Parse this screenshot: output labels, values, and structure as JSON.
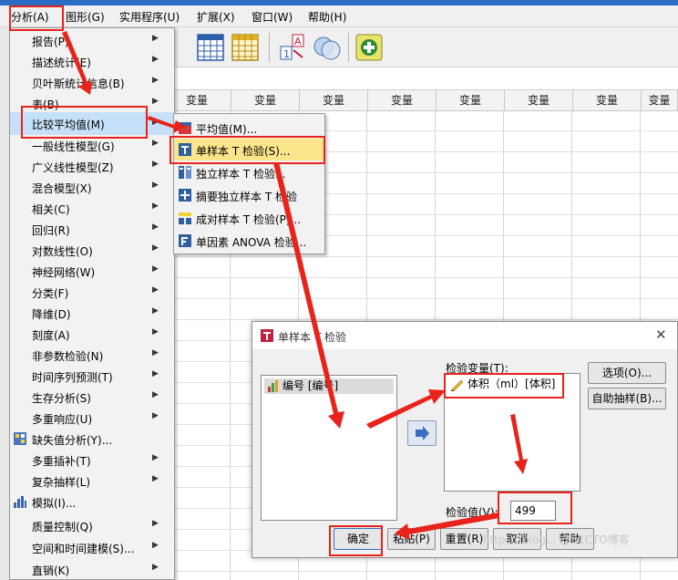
{
  "menubar": {
    "items": [
      "分析(A)",
      "图形(G)",
      "实用程序(U)",
      "扩展(X)",
      "窗口(W)",
      "帮助(H)"
    ]
  },
  "grid": {
    "column_header": "变量"
  },
  "analyze_menu": {
    "items": [
      {
        "label": "报告(P)",
        "submenu": true
      },
      {
        "label": "描述统计(E)",
        "submenu": true
      },
      {
        "label": "贝叶斯统计信息(B)",
        "submenu": true
      },
      {
        "label": "表(B)",
        "submenu": true
      },
      {
        "label": "比较平均值(M)",
        "submenu": true,
        "highlighted": true
      },
      {
        "label": "一般线性模型(G)",
        "submenu": true
      },
      {
        "label": "广义线性模型(Z)",
        "submenu": true
      },
      {
        "label": "混合模型(X)",
        "submenu": true
      },
      {
        "label": "相关(C)",
        "submenu": true
      },
      {
        "label": "回归(R)",
        "submenu": true
      },
      {
        "label": "对数线性(O)",
        "submenu": true
      },
      {
        "label": "神经网络(W)",
        "submenu": true
      },
      {
        "label": "分类(F)",
        "submenu": true
      },
      {
        "label": "降维(D)",
        "submenu": true
      },
      {
        "label": "刻度(A)",
        "submenu": true
      },
      {
        "label": "非参数检验(N)",
        "submenu": true
      },
      {
        "label": "时间序列预测(T)",
        "submenu": true
      },
      {
        "label": "生存分析(S)",
        "submenu": true
      },
      {
        "label": "多重响应(U)",
        "submenu": true
      },
      {
        "label": "缺失值分析(Y)...",
        "submenu": false,
        "icon": "missing-values-icon"
      },
      {
        "label": "多重插补(T)",
        "submenu": true
      },
      {
        "label": "复杂抽样(L)",
        "submenu": true
      },
      {
        "label": "模拟(I)...",
        "submenu": false,
        "icon": "simulation-icon"
      },
      {
        "label": "质量控制(Q)",
        "submenu": true
      },
      {
        "label": "空间和时间建模(S)...",
        "submenu": true
      },
      {
        "label": "直销(K)",
        "submenu": true
      }
    ]
  },
  "compare_means_menu": {
    "items": [
      {
        "label": "平均值(M)...",
        "icon": "means-icon"
      },
      {
        "label": "单样本 T 检验(S)...",
        "icon": "one-sample-t-icon",
        "highlighted": true
      },
      {
        "label": "独立样本 T 检验...",
        "icon": "independent-t-icon"
      },
      {
        "label": "摘要独立样本 T 检验",
        "icon": "summary-t-icon"
      },
      {
        "label": "成对样本 T 检验(P)...",
        "icon": "paired-t-icon"
      },
      {
        "label": "单因素 ANOVA 检验...",
        "icon": "anova-icon"
      }
    ]
  },
  "dialog": {
    "title": "单样本 T 检验",
    "source_list": [
      "编号 [编号]"
    ],
    "test_variables_label": "检验变量(T):",
    "test_variables": [
      "体积（ml）[体积]"
    ],
    "test_value_label": "检验值(V):",
    "test_value": "499",
    "options_button": "选项(O)...",
    "bootstrap_button": "自助抽样(B)...",
    "ok_button": "确定",
    "paste_button": "粘贴(P)",
    "reset_button": "重置(R)",
    "cancel_button": "取消",
    "help_button": "帮助"
  },
  "watermark": "https://blog... @51CTO博客",
  "colors": {
    "annotation_red": "#e8231b",
    "menu_highlight": "#c5e0f8",
    "submenu_highlight": "#fbe58a",
    "title_strip": "#2b6cc4"
  }
}
